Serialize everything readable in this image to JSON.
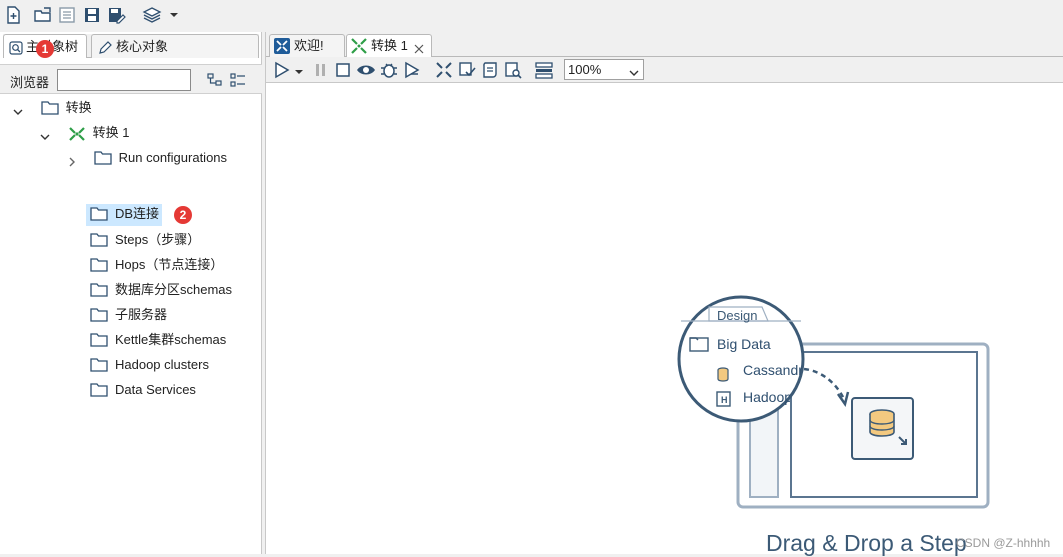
{
  "toolbar": {
    "icons": [
      "new-file-icon",
      "open-icon",
      "explore-repository-icon",
      "save-icon",
      "save-as-icon",
      "perspective-layers-icon",
      "dropdown-arrow-icon"
    ]
  },
  "left_panel": {
    "tabs": [
      {
        "label": "主对象树",
        "icon": "magnifier-icon"
      },
      {
        "label": "核心对象",
        "icon": "pencil-icon"
      }
    ],
    "browser_label": "浏览器",
    "search_value": "",
    "tree": {
      "root": "转换",
      "transformation": "转换 1",
      "children": [
        "Run configurations",
        "DB连接",
        "Steps（步骤）",
        "Hops（节点连接）",
        "数据库分区schemas",
        "子服务器",
        "Kettle集群schemas",
        "Hadoop clusters",
        "Data Services"
      ],
      "selected": "DB连接"
    },
    "badges": [
      "1",
      "2"
    ]
  },
  "right_panel": {
    "tabs": [
      {
        "label": "欢迎!",
        "icon": "welcome-icon"
      },
      {
        "label": "转换 1",
        "icon": "transformation-icon",
        "closable": true
      }
    ],
    "zoom": "100%",
    "illustration": {
      "tab_label": "Design",
      "folder_label": "Big Data",
      "items": [
        "Cassandr",
        "Hadoop"
      ]
    },
    "drag_drop_text": "Drag & Drop a Step",
    "watermark": "CSDN @Z-hhhhh"
  },
  "colors": {
    "selection": "#cce8ff",
    "badge": "#e53935",
    "accent": "#3c5a76",
    "green_icon": "#2e9e48"
  }
}
